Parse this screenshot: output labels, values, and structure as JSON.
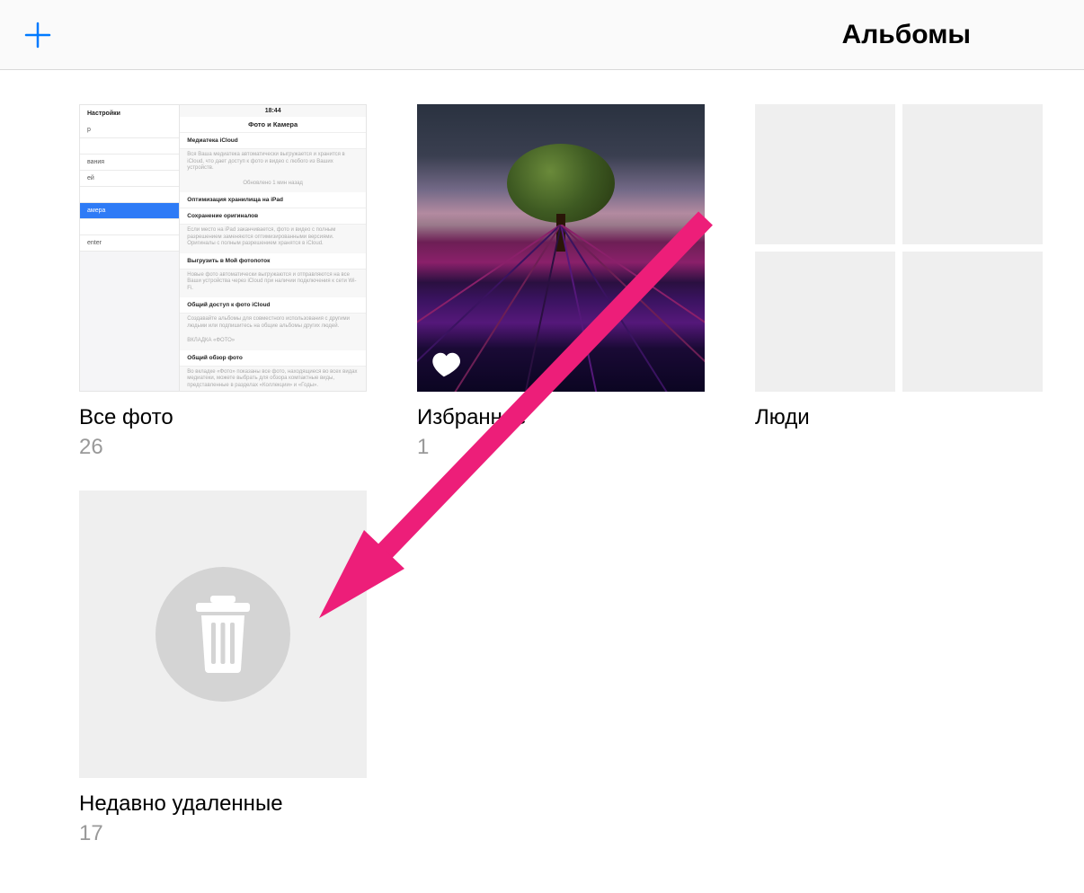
{
  "header": {
    "title": "Альбомы",
    "add_icon": "plus-icon"
  },
  "albums": [
    {
      "title": "Все фото",
      "count": "26",
      "type": "settings"
    },
    {
      "title": "Избранное",
      "count": "1",
      "type": "favorites"
    },
    {
      "title": "Люди",
      "count": "",
      "type": "people"
    },
    {
      "title": "Недавно удаленные",
      "count": "17",
      "type": "deleted"
    }
  ],
  "settings_mock": {
    "side_head": "Настройки",
    "time": "18:44",
    "main_head": "Фото и Камера",
    "item1": "Медиатека iCloud",
    "desc1": "Вся Ваша медиатека автоматически выгружается и хранится в iCloud, что дает доступ к фото и видео с любого из Ваших устройств.",
    "desc1b": "Обновлено 1 мин назад",
    "item2": "Оптимизация хранилища на iPad",
    "item3": "Сохранение оригиналов",
    "desc3": "Если место на iPad заканчивается, фото и видео с полным разрешением заменяются оптимизированными версиями. Оригиналы с полным разрешением хранятся в iCloud.",
    "item4": "Выгрузить в Мой фотопоток",
    "desc4": "Новые фото автоматически выгружаются и отправляются на все Ваши устройства через iCloud при наличии подключения к сети Wi-Fi.",
    "item5": "Общий доступ к фото iCloud",
    "desc5": "Создавайте альбомы для совместного использования с другими людьми или подпишитесь на общие альбомы других людей.",
    "desc5b": "ВКЛАДКА «ФОТО»",
    "item6": "Общий обзор фото",
    "desc6": "Во вкладке «Фото» показаны все фото, находящиеся во всех видах медиатеки, можете выбрать для обзора компактные виды, представленные в разделах «Коллекции» и «Годы».",
    "side_rows": [
      "р",
      "",
      "вания",
      "ей",
      "",
      "амера",
      "",
      "enter"
    ]
  },
  "colors": {
    "accent_blue": "#007aff",
    "arrow": "#ed1e79"
  }
}
